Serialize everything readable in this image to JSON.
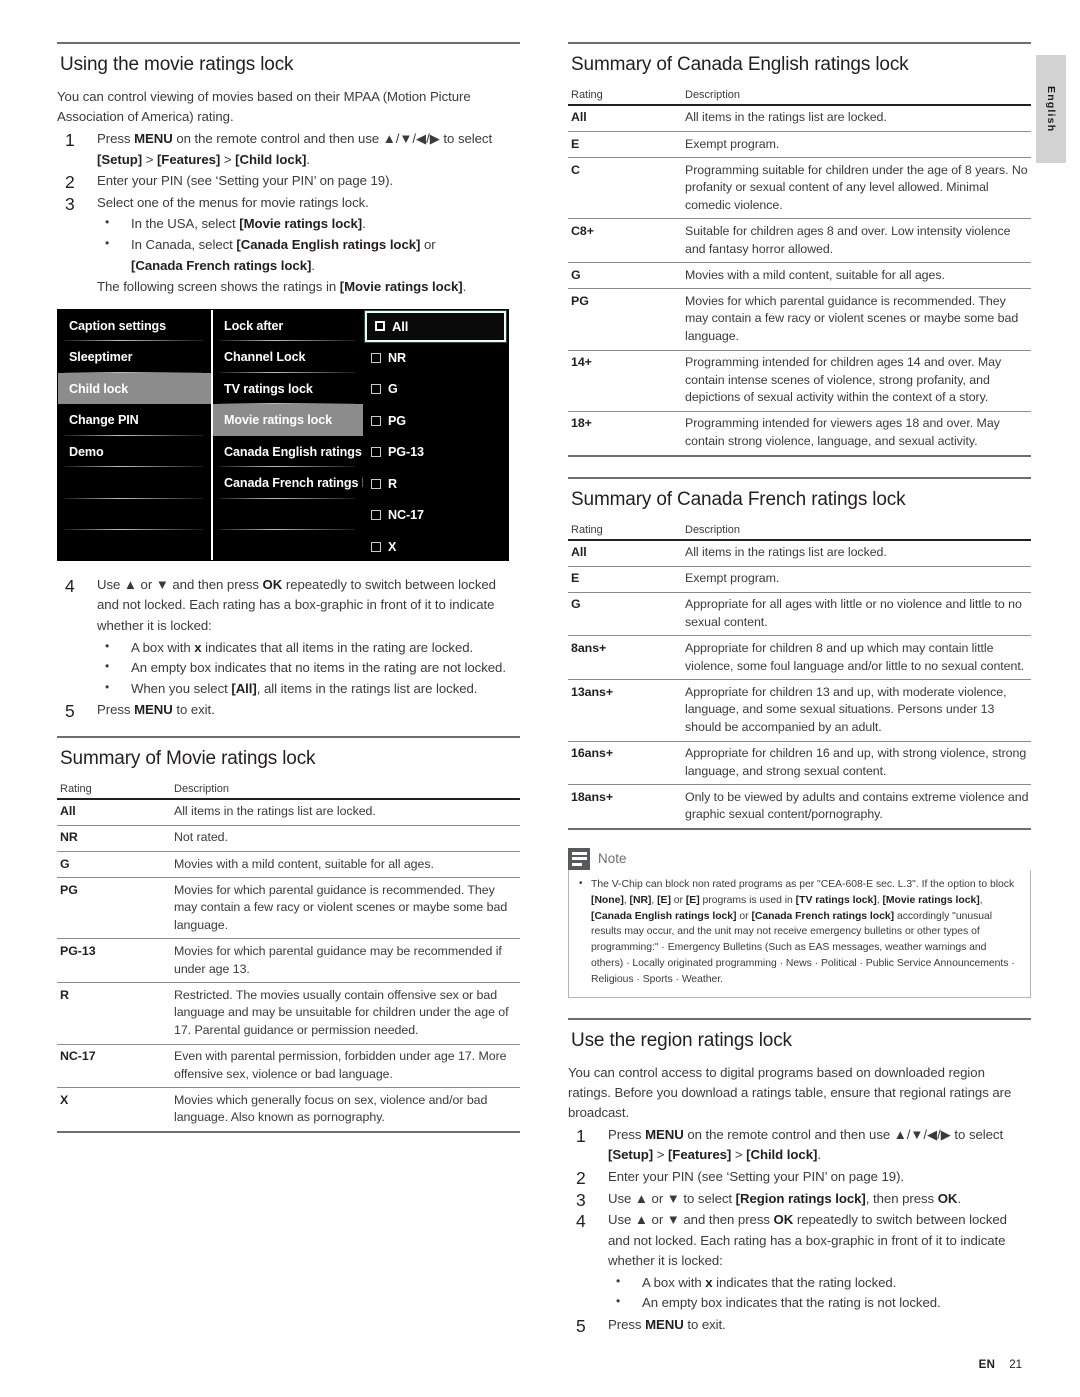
{
  "side_tab": {
    "label": "English"
  },
  "footer": {
    "lang_code": "EN",
    "page_number": "21"
  },
  "left": {
    "heading": "Using the movie ratings lock",
    "intro": "You can control viewing of movies based on their MPAA (Motion Picture Association of America) rating.",
    "steps": [
      {
        "num": "1",
        "text_parts": [
          "Press ",
          "MENU",
          " on the remote control and then use ▲/▼/◀/▶ to select ",
          "[Setup]",
          " > ",
          "[Features]",
          " > ",
          "[Child lock]",
          "."
        ]
      },
      {
        "num": "2",
        "text": "Enter your PIN (see ‘Setting your PIN’ on page 19)."
      },
      {
        "num": "3",
        "text": "Select one of the menus for movie ratings lock."
      }
    ],
    "step3_bullets": [
      {
        "pre": "In the USA, select ",
        "bold": "[Movie ratings lock]",
        "post": "."
      },
      {
        "pre": "In Canada, select ",
        "bold": "[Canada English ratings lock]",
        "post": " or"
      },
      {
        "bold2": "[Canada French ratings lock]",
        "post2": "."
      }
    ],
    "following_screen": {
      "pre": "The following screen shows the ratings in ",
      "bold": "[Movie ratings lock]",
      "post": "."
    },
    "osd": {
      "col1": [
        {
          "label": "Caption settings",
          "highlighted": false
        },
        {
          "label": "Sleeptimer",
          "highlighted": false
        },
        {
          "label": "Child lock",
          "highlighted": true
        },
        {
          "label": "Change PIN",
          "highlighted": false
        },
        {
          "label": "Demo",
          "highlighted": false
        },
        {
          "label": "",
          "highlighted": false
        },
        {
          "label": "",
          "highlighted": false
        },
        {
          "label": "",
          "highlighted": false
        }
      ],
      "col2": [
        {
          "label": "Lock after",
          "highlighted": false
        },
        {
          "label": "Channel Lock",
          "highlighted": false
        },
        {
          "label": "TV ratings lock",
          "highlighted": false
        },
        {
          "label": "Movie ratings lock",
          "highlighted": true
        },
        {
          "label": "Canada English ratings l...",
          "highlighted": false
        },
        {
          "label": "Canada French ratings l...",
          "highlighted": false
        },
        {
          "label": "",
          "highlighted": false
        },
        {
          "label": "",
          "highlighted": false
        }
      ],
      "col3": [
        {
          "label": "All",
          "selected": true
        },
        {
          "label": "NR",
          "selected": false
        },
        {
          "label": "G",
          "selected": false
        },
        {
          "label": "PG",
          "selected": false
        },
        {
          "label": "PG-13",
          "selected": false
        },
        {
          "label": "R",
          "selected": false
        },
        {
          "label": "NC-17",
          "selected": false
        },
        {
          "label": "X",
          "selected": false
        }
      ]
    },
    "step4": {
      "num": "4",
      "text": "Use ▲ or ▼ and then press OK repeatedly to switch between locked and not locked. Each rating has a box-graphic in front of it to indicate whether it is locked:",
      "bullets": [
        "A box with x indicates that all items in the rating are locked.",
        "An empty box indicates that no items in the rating are not locked.",
        "When you select [All], all items in the ratings list are locked."
      ]
    },
    "step5": {
      "num": "5",
      "text": "Press MENU to exit."
    },
    "movie_table": {
      "heading": "Summary of Movie ratings lock",
      "columns": [
        "Rating",
        "Description"
      ],
      "rows": [
        [
          "All",
          "All items in the ratings list are locked."
        ],
        [
          "NR",
          "Not rated."
        ],
        [
          "G",
          "Movies with a mild content, suitable for all ages."
        ],
        [
          "PG",
          "Movies for which parental guidance is recommended. They may contain a few racy or violent scenes or maybe some bad language."
        ],
        [
          "PG-13",
          "Movies for which parental guidance may be recommended if under age 13."
        ],
        [
          "R",
          "Restricted. The movies usually contain offensive sex or bad language and may be unsuitable for children under the age of 17. Parental guidance or permission needed."
        ],
        [
          "NC-17",
          "Even with parental permission, forbidden under age 17. More offensive sex, violence or bad language."
        ],
        [
          "X",
          "Movies which generally focus on sex, violence and/or bad language. Also known as pornography."
        ]
      ]
    }
  },
  "right": {
    "canada_english": {
      "heading": "Summary of Canada English ratings lock",
      "columns": [
        "Rating",
        "Description"
      ],
      "rows": [
        [
          "All",
          "All items in the ratings list are locked."
        ],
        [
          "E",
          "Exempt program."
        ],
        [
          "C",
          "Programming suitable for children under the age of 8 years. No profanity or sexual content of any level allowed. Minimal comedic violence."
        ],
        [
          "C8+",
          "Suitable for children ages 8 and over. Low intensity violence and fantasy horror allowed."
        ],
        [
          "G",
          "Movies with a mild content, suitable for all ages."
        ],
        [
          "PG",
          "Movies for which parental guidance is recommended. They may contain a few racy or violent scenes or maybe some bad language."
        ],
        [
          "14+",
          "Programming intended for children ages 14 and over. May contain intense scenes of violence, strong profanity, and depictions of sexual activity within the context of a story."
        ],
        [
          "18+",
          "Programming intended for viewers ages 18 and over. May contain strong violence, language, and sexual activity."
        ]
      ]
    },
    "canada_french": {
      "heading": "Summary of Canada French ratings lock",
      "columns": [
        "Rating",
        "Description"
      ],
      "rows": [
        [
          "All",
          "All items in the ratings list are locked."
        ],
        [
          "E",
          "Exempt program."
        ],
        [
          "G",
          "Appropriate for all ages with little or no violence and little to no sexual content."
        ],
        [
          "8ans+",
          "Appropriate for children 8 and up which may contain little violence, some foul language and/or little to no sexual content."
        ],
        [
          "13ans+",
          "Appropriate for children 13 and up, with moderate violence, language, and some sexual situations. Persons under 13 should be accompanied by an adult."
        ],
        [
          "16ans+",
          "Appropriate for children 16 and up, with strong violence, strong language, and strong sexual content."
        ],
        [
          "18ans+",
          "Only to be viewed by adults and contains extreme violence and graphic sexual content/pornography."
        ]
      ]
    },
    "note": {
      "title": "Note",
      "text_p1": "The V-Chip can block non rated programs as per \"CEA-608-E sec. L.3\". If the option to block ",
      "b1": "[None]",
      "t2": ", ",
      "b2": "[NR]",
      "t3": ", ",
      "b3": "[E]",
      "t4": " or ",
      "b4": "[E]",
      "t5": " programs is used in ",
      "b5": "[TV ratings lock]",
      "t6": ", ",
      "b6": "[Movie ratings lock]",
      "t7": ", ",
      "b7": "[Canada English ratings lock]",
      "t8": " or ",
      "b8": "[Canada French ratings lock]",
      "t9": " accordingly \"unusual results may occur, and the unit may not receive emergency bulletins or other types of programming:\" · Emergency Bulletins (Such as EAS messages, weather warnings and others) · Locally originated programming · News · Political · Public Service Announcements · Religious · Sports · Weather."
    },
    "region": {
      "heading": "Use the region ratings lock",
      "intro": "You can control access to digital programs based on downloaded region ratings. Before you download a ratings table, ensure that regional ratings are broadcast.",
      "steps": [
        {
          "num": "1",
          "text": "Press MENU on the remote control and then use ▲/▼/◀/▶ to select [Setup] > [Features] > [Child lock]."
        },
        {
          "num": "2",
          "text": "Enter your PIN (see ‘Setting your PIN’ on page 19)."
        },
        {
          "num": "3",
          "text": "Use ▲ or ▼ to select [Region ratings lock], then press OK."
        },
        {
          "num": "4",
          "text": "Use ▲ or ▼ and then press OK repeatedly to switch between locked and not locked. Each rating has a box-graphic in front of it to indicate whether it is locked:"
        }
      ],
      "step4_bullets": [
        "A box with x indicates that the rating locked.",
        "An empty box indicates that the rating is not locked."
      ],
      "step5": {
        "num": "5",
        "text": "Press MENU to exit."
      }
    }
  }
}
